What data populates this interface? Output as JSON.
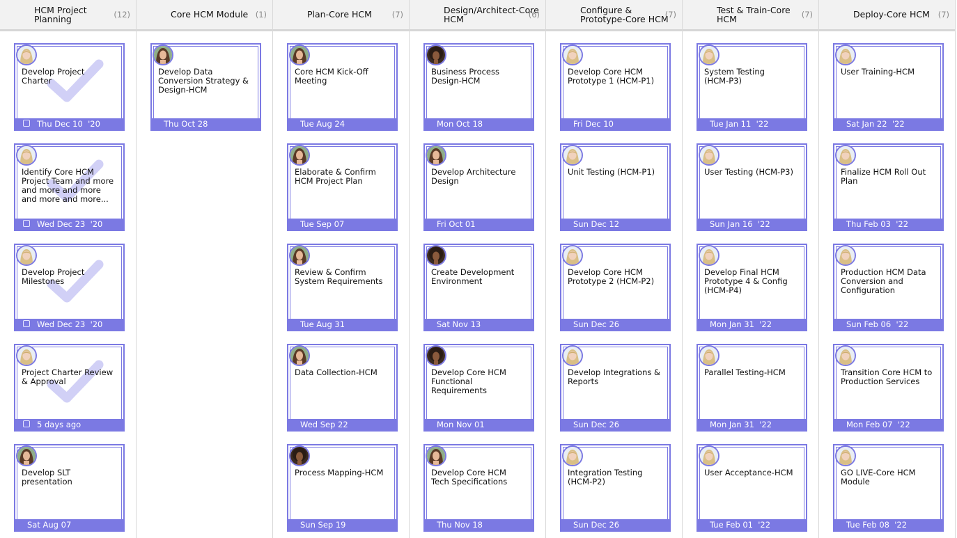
{
  "colors": {
    "accent": "#7b79e3",
    "header_bg": "#f2f2f2",
    "check": "#c9c8f5"
  },
  "columns": [
    {
      "title": "HCM Project\nPlanning",
      "count": "(12)",
      "cards": [
        {
          "title": "Develop Project\nCharter",
          "date": "Thu Dec 10  '20",
          "avatar": "blonde-avatar",
          "done": true
        },
        {
          "title": "Identify Core HCM\nProject Team and more\nand more and more\nand more and more...",
          "date": "Wed Dec 23  '20",
          "avatar": "blonde-avatar",
          "done": true
        },
        {
          "title": "Develop Project\nMilestones",
          "date": "Wed Dec 23  '20",
          "avatar": "blonde-avatar",
          "done": true
        },
        {
          "title": "Project Charter Review\n& Approval",
          "date": "5 days ago",
          "avatar": "blonde-avatar",
          "done": true
        },
        {
          "title": "Develop SLT\npresentation",
          "date": "Sat Aug 07",
          "avatar": "brunette-avatar",
          "done": false
        }
      ]
    },
    {
      "title": "Core HCM Module",
      "count": "(1)",
      "cards": [
        {
          "title": "Develop Data\nConversion Strategy &\nDesign-HCM",
          "date": "Thu Oct 28",
          "avatar": "brunette-avatar",
          "done": false
        }
      ]
    },
    {
      "title": "Plan-Core HCM",
      "count": "(7)",
      "cards": [
        {
          "title": "Core HCM Kick-Off\nMeeting",
          "date": "Tue Aug 24",
          "avatar": "brunette-avatar",
          "done": false
        },
        {
          "title": "Elaborate & Confirm\nHCM Project Plan",
          "date": "Tue Sep 07",
          "avatar": "brunette-avatar",
          "done": false
        },
        {
          "title": "Review & Confirm\nSystem Requirements",
          "date": "Tue Aug 31",
          "avatar": "brunette-avatar",
          "done": false
        },
        {
          "title": "Data Collection-HCM",
          "date": "Wed Sep 22",
          "avatar": "brunette-avatar",
          "done": false
        },
        {
          "title": "Process Mapping-HCM",
          "date": "Sun Sep 19",
          "avatar": "curly-avatar",
          "done": false
        }
      ]
    },
    {
      "title": "Design/Architect-Core\nHCM",
      "count": "(6)",
      "cards": [
        {
          "title": "Business Process\nDesign-HCM",
          "date": "Mon Oct 18",
          "avatar": "curly-avatar",
          "done": false
        },
        {
          "title": "Develop Architecture\nDesign",
          "date": "Fri Oct 01",
          "avatar": "brunette-avatar",
          "done": false
        },
        {
          "title": "Create Development\nEnvironment",
          "date": "Sat Nov 13",
          "avatar": "curly-avatar",
          "done": false
        },
        {
          "title": "Develop Core HCM\nFunctional\nRequirements",
          "date": "Mon Nov 01",
          "avatar": "curly-avatar",
          "done": false
        },
        {
          "title": "Develop Core HCM\nTech Specifications",
          "date": "Thu Nov 18",
          "avatar": "brunette-avatar",
          "done": false
        }
      ]
    },
    {
      "title": "Configure &\nPrototype-Core HCM",
      "count": "(7)",
      "cards": [
        {
          "title": "Develop Core HCM\nPrototype 1 (HCM-P1)",
          "date": "Fri Dec 10",
          "avatar": "blonde-avatar",
          "done": false
        },
        {
          "title": "Unit Testing (HCM-P1)",
          "date": "Sun Dec 12",
          "avatar": "blonde-avatar",
          "done": false
        },
        {
          "title": "Develop Core HCM\nPrototype 2 (HCM-P2)",
          "date": "Sun Dec 26",
          "avatar": "blonde-avatar",
          "done": false
        },
        {
          "title": "Develop Integrations &\nReports",
          "date": "Sun Dec 26",
          "avatar": "blonde-avatar",
          "done": false
        },
        {
          "title": "Integration Testing\n(HCM-P2)",
          "date": "Sun Dec 26",
          "avatar": "blonde-avatar",
          "done": false
        }
      ]
    },
    {
      "title": "Test & Train-Core\nHCM",
      "count": "(7)",
      "cards": [
        {
          "title": "System Testing\n(HCM-P3)",
          "date": "Tue Jan 11  '22",
          "avatar": "blonde-avatar",
          "done": false
        },
        {
          "title": "User Testing (HCM-P3)",
          "date": "Sun Jan 16  '22",
          "avatar": "blonde-avatar",
          "done": false
        },
        {
          "title": "Develop Final HCM\nPrototype 4 & Config\n(HCM-P4)",
          "date": "Mon Jan 31  '22",
          "avatar": "blonde-avatar",
          "done": false
        },
        {
          "title": "Parallel Testing-HCM",
          "date": "Mon Jan 31  '22",
          "avatar": "blonde-avatar",
          "done": false
        },
        {
          "title": "User Acceptance-HCM",
          "date": "Tue Feb 01  '22",
          "avatar": "blonde-avatar",
          "done": false
        }
      ]
    },
    {
      "title": "Deploy-Core HCM",
      "count": "(7)",
      "cards": [
        {
          "title": "User Training-HCM",
          "date": "Sat Jan 22  '22",
          "avatar": "blonde-avatar",
          "done": false
        },
        {
          "title": "Finalize HCM Roll Out\nPlan",
          "date": "Thu Feb 03  '22",
          "avatar": "blonde-avatar",
          "done": false
        },
        {
          "title": "Production HCM Data\nConversion and\nConfiguration",
          "date": "Sun Feb 06  '22",
          "avatar": "blonde-avatar",
          "done": false
        },
        {
          "title": "Transition Core HCM to\nProduction Services",
          "date": "Mon Feb 07  '22",
          "avatar": "blonde-avatar",
          "done": false
        },
        {
          "title": "GO LIVE-Core HCM\nModule",
          "date": "Tue Feb 08  '22",
          "avatar": "blonde-avatar",
          "done": false
        }
      ]
    }
  ]
}
